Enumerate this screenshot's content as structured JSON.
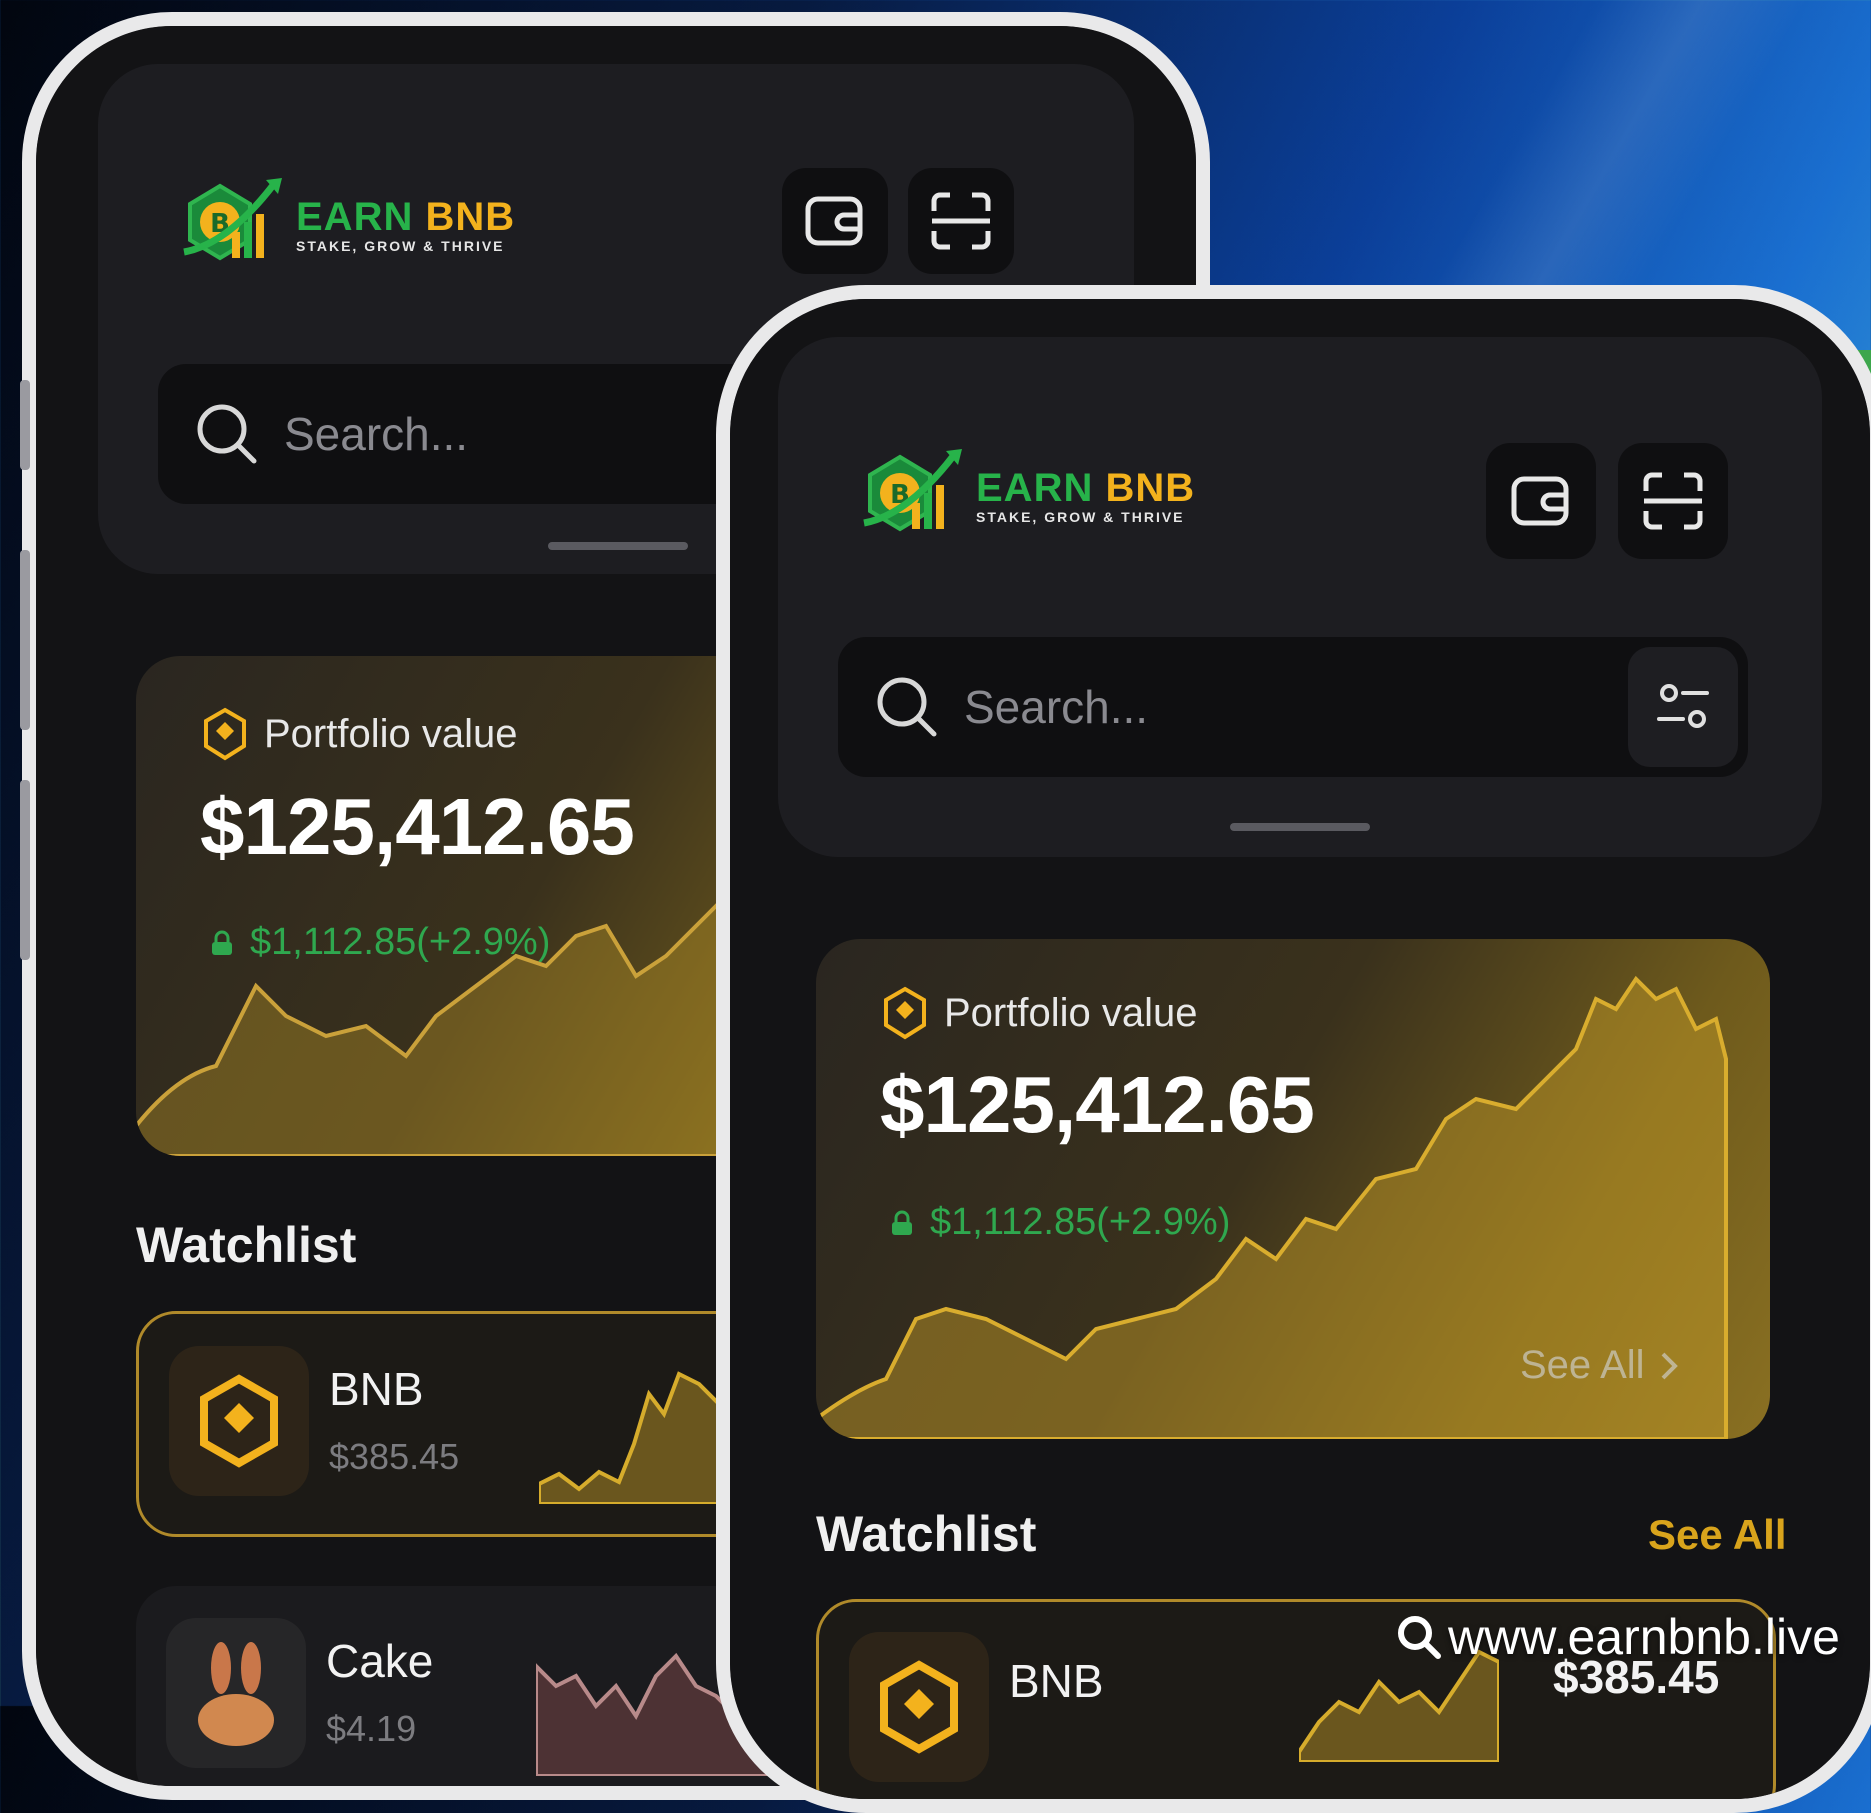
{
  "brand": {
    "name_part1": "EARN",
    "name_part2": "BNB",
    "tagline": "STAKE, GROW & THRIVE",
    "green": "#27b34a",
    "gold": "#f3b21d"
  },
  "search": {
    "placeholder": "Search..."
  },
  "portfolio": {
    "label": "Portfolio value",
    "value": "$125,412.65",
    "change": "$1,112.85(+2.9%)",
    "see_all": "See All"
  },
  "watchlist": {
    "title": "Watchlist",
    "see_all": "See All",
    "items": [
      {
        "name": "BNB",
        "price": "$385.45"
      },
      {
        "name": "Cake",
        "price": "$4.19"
      }
    ]
  },
  "website": "www.earnbnb.live",
  "icons": [
    "wallet-icon",
    "scan-icon",
    "search-icon",
    "filter-icon",
    "bnb-coin-icon",
    "cake-coin-icon",
    "chevron-right-icon"
  ]
}
